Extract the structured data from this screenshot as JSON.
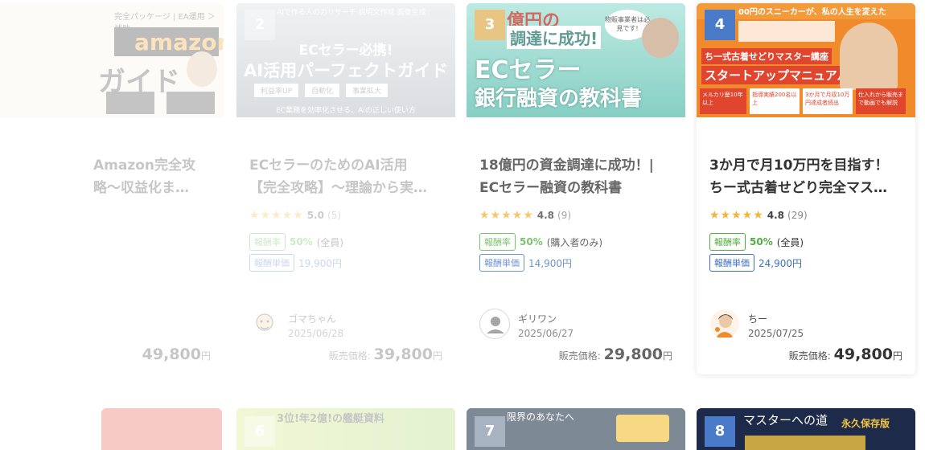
{
  "cards": [
    {
      "rank": "",
      "thumb_top": "完全パッケージ | EA運用 ＞ 補助",
      "thumb_brand": "amazon",
      "thumb_sub": "ガイド",
      "title_l1": "Amazon完全攻",
      "title_l2": "略〜収益化ま…"
    },
    {
      "rank": "2",
      "thumb_top": "AIで作る人の力リサーチ 説明文作成 画像生成",
      "thumb_l1": "ECセラー必携!",
      "thumb_l2": "AI活用パーフェクトガイド",
      "thumb_chips": [
        "利益率UP",
        "自動化",
        "事業拡大"
      ],
      "thumb_bottom": "EC業務を効率化させる、AIの正しい使い方",
      "title_l1": "ECセラーのためのAI活用",
      "title_l2": "【完全攻略】〜理論から実…",
      "score": "5.0",
      "count": "(5)",
      "rate_label": "報酬率",
      "rate": "50%",
      "rate_note": "(全員)",
      "unit_label": "報酬単価",
      "unit_price": "19,900円",
      "author": "ゴマちゃん",
      "date": "2025/06/28",
      "sale_label": "販売価格:",
      "sale_price": "39,800",
      "sale_unit": "円"
    },
    {
      "rank": "3",
      "thumb_top": "億円の",
      "thumb_mid": "調達に成功!",
      "thumb_bubble": "物販事業者は必見です!",
      "thumb_l1": "ECセラー",
      "thumb_l2": "銀行融資の教科書",
      "title_l1": "18億円の資金調達に成功！|",
      "title_l2": "ECセラー融資の教科書",
      "score": "4.8",
      "count": "(9)",
      "rate_label": "報酬率",
      "rate": "50%",
      "rate_note": "(購入者のみ)",
      "unit_label": "報酬単価",
      "unit_price": "14,900円",
      "author": "ギリワン",
      "date": "2025/06/27",
      "sale_label": "販売価格:",
      "sale_price": "29,800",
      "sale_unit": "円"
    },
    {
      "rank": "4",
      "thumb_top": "00円のスニーカーが、私の人生を変えた",
      "thumb_mid": "ち一式古着せどりマスター講座",
      "thumb_l2": "スタートアップマニュアル編",
      "thumb_badges": [
        "メルカリ歴10年以上",
        "指導実績200名以上",
        "3か月で月収10万円達成者続出",
        "仕入れから販売まで動画でも解説"
      ],
      "title_l1": "3か月で月10万円を目指す！",
      "title_l2": "ちー式古着せどり完全マス…",
      "score": "4.8",
      "count": "(29)",
      "rate_label": "報酬率",
      "rate": "50%",
      "rate_note": "(全員)",
      "unit_label": "報酬単価",
      "unit_price": "24,900円",
      "author": "ちー",
      "date": "2025/07/25",
      "sale_label": "販売価格:",
      "sale_price": "49,800",
      "sale_unit": "円"
    }
  ],
  "first_card_sale_price": "49,800",
  "first_card_sale_unit": "円",
  "row2": [
    {
      "rank": "",
      "text": ""
    },
    {
      "rank": "6",
      "text": "3位!年2億!の艦艇資料"
    },
    {
      "rank": "7",
      "text": "限界のあなたへ"
    },
    {
      "rank": "8",
      "text": "マスターへの道",
      "badge": "永久保存版"
    }
  ],
  "stars": "★★★★★",
  "colors": {
    "rank2": "#e6e6e6",
    "rank3": "#e0b25a",
    "rank4": "#4a7bc8",
    "green": "#4fae3e",
    "blue": "#3c6fc0",
    "star": "#f4b63a"
  }
}
